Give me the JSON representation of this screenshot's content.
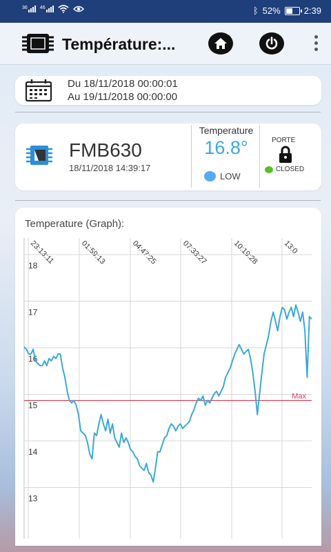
{
  "status_bar": {
    "signal_left": "36",
    "signal_right": "46",
    "battery_percent": "52%",
    "battery_level": 0.52,
    "time": "2:39",
    "icons": [
      "signal-icon",
      "wifi-icon",
      "eye-icon",
      "bluetooth-icon",
      "battery-icon"
    ]
  },
  "appbar": {
    "title": "Température:...",
    "icons": [
      "chip-icon",
      "home-icon",
      "power-icon",
      "more-vert-icon"
    ]
  },
  "date_range": {
    "from": "Du 18/11/2018 00:00:01",
    "to": "Au 19/11/2018 00:00:00",
    "icon": "calendar-icon"
  },
  "device": {
    "name": "FMB630",
    "timestamp": "18/11/2018 14:39:17",
    "icon": "device-chip-icon",
    "temperature_label": "Temperature",
    "temperature_value": "16.8°",
    "level_text": "LOW",
    "level_color": "#55aaf0",
    "door_label": "PORTE",
    "door_status": "CLOSED",
    "door_color": "#55c020",
    "door_icon": "lock-icon"
  },
  "graph": {
    "title": "Temperature (Graph):"
  },
  "chart_data": {
    "type": "line",
    "title": "Temperature (Graph):",
    "x_tick_labels": [
      "23:13:11",
      "01:59:13",
      "04:47:25",
      "07:33:27",
      "10:19:28",
      "13:0"
    ],
    "y_tick_labels": [
      "18",
      "17",
      "16",
      "15",
      "14",
      "13"
    ],
    "ylim": [
      12.5,
      18.25
    ],
    "grid": true,
    "line_color": "#3aa8d8",
    "threshold": {
      "label": "Max",
      "value": 15.0,
      "color": "#d0405a"
    },
    "series": [
      {
        "values": [
          16.15,
          16.1,
          16.0,
          16.0,
          16.1,
          15.85,
          15.8,
          15.75,
          15.75,
          15.85,
          15.75,
          15.9,
          15.85,
          15.95,
          15.9,
          16.0,
          16.0,
          15.7,
          15.5,
          15.2,
          15.0,
          14.95,
          15.0,
          14.9,
          14.7,
          14.35,
          14.3,
          14.25,
          14.1,
          13.85,
          13.75,
          14.3,
          14.25,
          14.5,
          14.7,
          14.5,
          14.35,
          14.6,
          14.3,
          14.5,
          14.2,
          14.1,
          14.0,
          14.3,
          14.1,
          14.2,
          14.1,
          13.95,
          13.9,
          13.8,
          13.75,
          13.6,
          13.55,
          13.5,
          13.65,
          13.45,
          13.4,
          13.25,
          13.55,
          13.9,
          13.9,
          14.05,
          14.2,
          14.25,
          14.4,
          14.5,
          14.45,
          14.35,
          14.45,
          14.5,
          14.4,
          14.45,
          14.5,
          14.55,
          14.7,
          14.8,
          14.95,
          15.05,
          15.0,
          15.1,
          14.9,
          15.0,
          14.95,
          15.05,
          15.15,
          15.2,
          15.1,
          15.2,
          15.3,
          15.5,
          15.6,
          15.7,
          15.85,
          16.0,
          16.1,
          16.2,
          16.1,
          16.0,
          16.05,
          16.1,
          15.9,
          15.6,
          15.2,
          14.7,
          15.15,
          15.6,
          16.0,
          16.2,
          16.4,
          16.7,
          16.9,
          16.7,
          16.5,
          16.8,
          17.0,
          16.95,
          16.75,
          16.9,
          17.0,
          16.8,
          17.05,
          16.9,
          16.7,
          16.9,
          16.5,
          15.5,
          16.8,
          16.75
        ]
      }
    ]
  }
}
